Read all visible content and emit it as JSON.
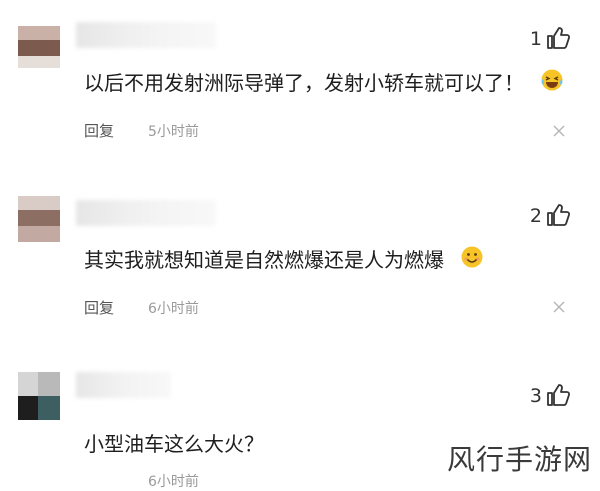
{
  "comments": [
    {
      "likes": "1",
      "text": "以后不用发射洲际导弹了，发射小轿车就可以了！",
      "emoji": "laughing-tears-emoji",
      "reply_label": "回复",
      "time": "5小时前"
    },
    {
      "likes": "2",
      "text": "其实我就想知道是自然燃爆还是人为燃爆",
      "emoji": "grinning-emoji",
      "reply_label": "回复",
      "time": "6小时前"
    },
    {
      "likes": "3",
      "text": "小型油车这么大火？",
      "emoji": "",
      "reply_label": "",
      "time": "6小时前"
    }
  ],
  "watermark": "风行手游网",
  "icons": {
    "like": "thumbs-up-icon",
    "close": "close-icon"
  },
  "colors": {
    "text": "#1e1e1e",
    "muted": "#9a9a9a",
    "emoji_yellow": "#f7c428"
  }
}
